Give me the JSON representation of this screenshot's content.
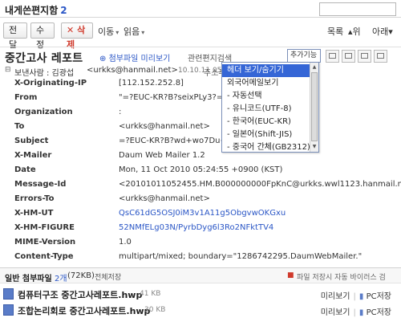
{
  "mailbox": {
    "title": "내게쓴편지함",
    "count": "2"
  },
  "toolbar": {
    "reply": "전달",
    "edit": "수정",
    "delete": "삭제",
    "move": "이동",
    "read": "읽음",
    "list": "목록",
    "prev": "위",
    "next": "아래"
  },
  "message": {
    "subject": "중간고사 레포트",
    "attach_preview": "첨부파일 미리보기",
    "related_search": "관련편지검색",
    "extra_func": "추가기능",
    "sender_label": "보낸사람 : 김광섭",
    "sender_email": "<urkks@hanmail.net>",
    "sender_date": "10.10.11 05:24",
    "address_add": "주소추가",
    "headers": [
      {
        "key": "X-Originating-IP",
        "value": "[112.152.252.8]",
        "blue": false
      },
      {
        "key": "From",
        "value": "\"=?EUC-KR?B?seixPLy3?=\" <urk",
        "blue": false
      },
      {
        "key": "Organization",
        "value": ":",
        "blue": false
      },
      {
        "key": "To",
        "value": "<urkks@hanmail.net>",
        "blue": false
      },
      {
        "key": "Subject",
        "value": "=?EUC-KR?B?wd+wo7Du+cgt7o",
        "blue": false
      },
      {
        "key": "X-Mailer",
        "value": "Daum Web Mailer 1.2",
        "blue": false
      },
      {
        "key": "Date",
        "value": "Mon, 11 Oct 2010 05:24:55 +0900 (KST)",
        "blue": false
      },
      {
        "key": "Message-Id",
        "value": "<20101011052455.HM.B000000000FpKnC@urkks.wwl1123.hanmail.net>",
        "blue": false
      },
      {
        "key": "Errors-To",
        "value": "<urkks@hanmail.net>",
        "blue": false
      },
      {
        "key": "X-HM-UT",
        "value": "QsC61dG5OSJ0iM3v1A11g5ObgvwOKGxu",
        "blue": true
      },
      {
        "key": "X-HM-FIGURE",
        "value": "52NMfELg03N/PyrbDyg6l3Ro2NFktTV4",
        "blue": true
      },
      {
        "key": "MIME-Version",
        "value": "1.0",
        "blue": false
      },
      {
        "key": "Content-Type",
        "value": "multipart/mixed; boundary=\"1286742295.DaumWebMailer.\"",
        "blue": false
      }
    ]
  },
  "dropdown": {
    "items": [
      "헤더 보기/숨기기",
      "외국어메일보기",
      "- 자동선택",
      "- 유니코드(UTF-8)",
      "- 한국어(EUC-KR)",
      "- 일본어(Shift-JIS)",
      "- 중국어 간체(GB2312)"
    ],
    "selected": 0
  },
  "attachments": {
    "label": "일반 첨부파일",
    "count_text": "2개",
    "total_size": "(72KB)",
    "save_all": "전체저장",
    "auto_notice": "파일 저장시 자동 바이러스 검",
    "files": [
      {
        "name": "컴퓨터구조 중간고사레포트.hwp",
        "size": "41 KB",
        "preview": "미리보기",
        "save": "PC저장"
      },
      {
        "name": "조합논리회로 중간고사레포트.hwp",
        "size": "30 KB",
        "preview": "미리보기",
        "save": "PC저장"
      }
    ]
  },
  "colors": {
    "accent": "#2a56c6",
    "selection": "#3566d6",
    "delete_red": "#d03a2c"
  },
  "icons": [
    "search-icon",
    "delete-x-icon",
    "attachment-icon",
    "file-hwp-icon",
    "print-icon",
    "shield-icon"
  ]
}
